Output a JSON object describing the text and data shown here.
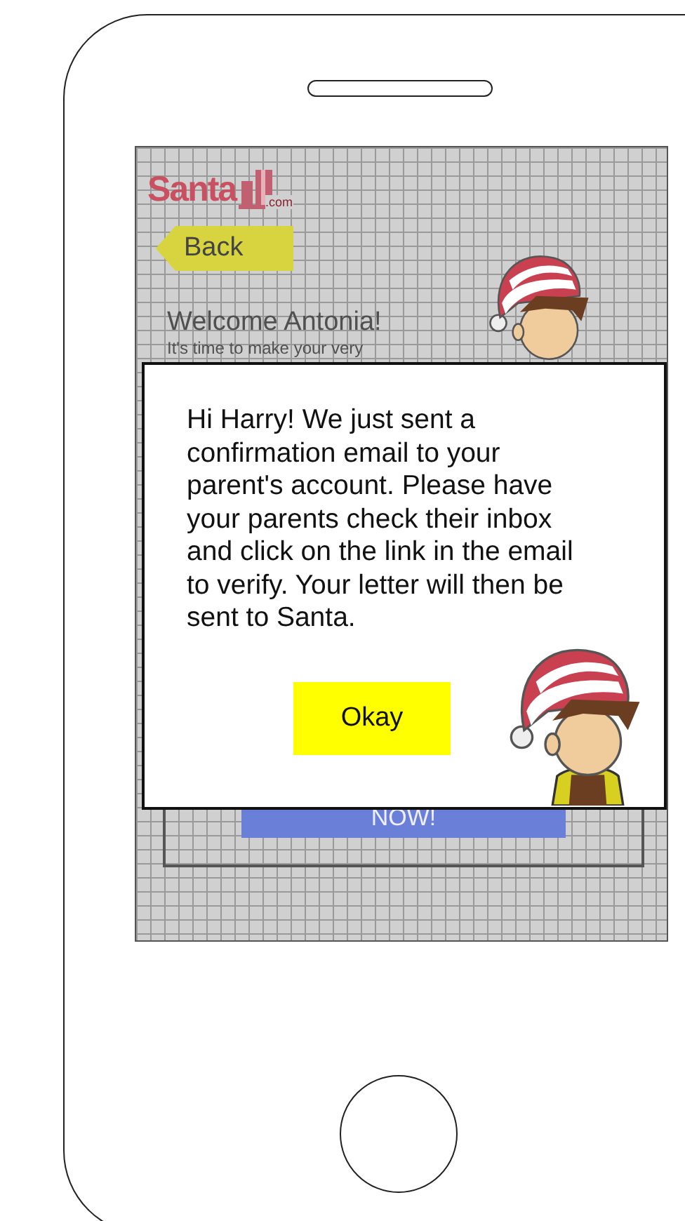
{
  "app": {
    "logo": "Santa",
    "logo_suffix": ".com",
    "back_button": "Back",
    "welcome": "Welcome Antonia!",
    "intro": "It's time to make your very",
    "cta_button": "NOW!"
  },
  "dialog": {
    "message": "Hi Harry! We just sent a confirmation email to your parent's account. Please have your parents check their inbox and click on the link in the email to verify. Your letter will then be sent to Santa.",
    "button": "Okay"
  }
}
